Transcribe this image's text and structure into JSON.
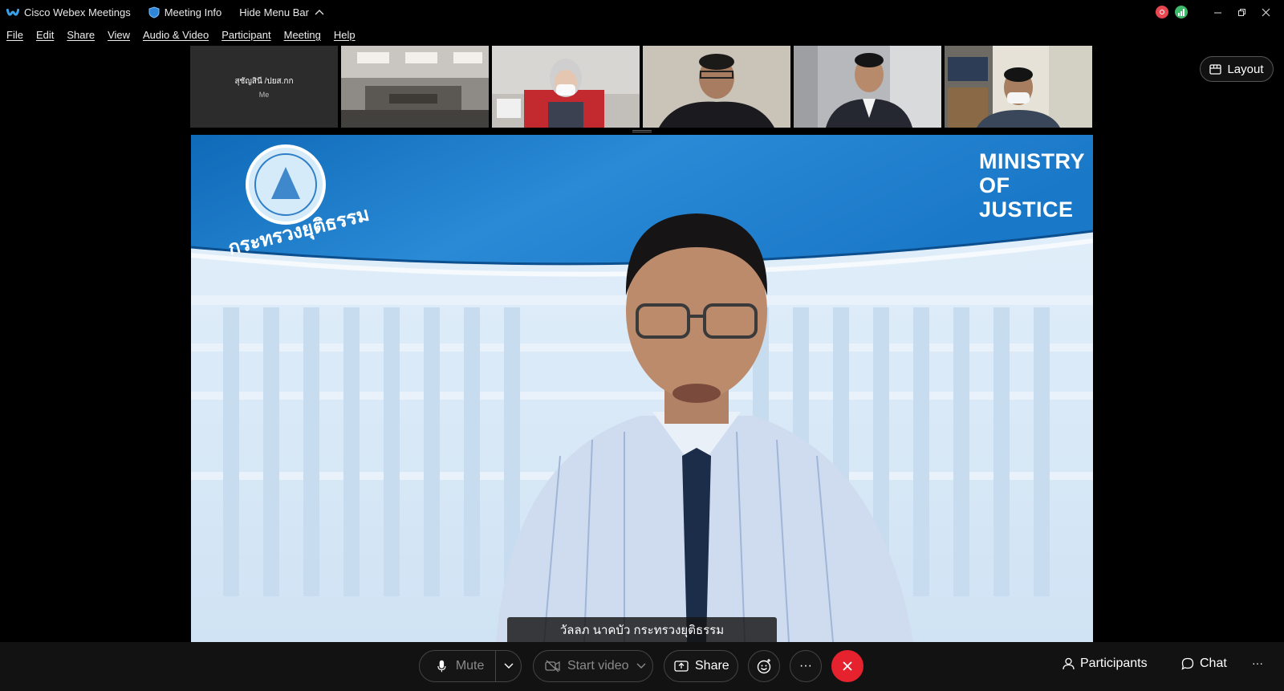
{
  "titlebar": {
    "app_name": "Cisco Webex Meetings",
    "meeting_info": "Meeting Info",
    "hide_menu": "Hide Menu Bar",
    "record_color": "#e8474f",
    "signal_color": "#3dbb6a"
  },
  "menu": [
    "File",
    "Edit",
    "Share",
    "View",
    "Audio & Video",
    "Participant",
    "Meeting",
    "Help"
  ],
  "thumbnails": {
    "me_name": "สุชัญสินี /ปยส.กก",
    "me_label": "Me"
  },
  "layout_label": "Layout",
  "main_video": {
    "banner_title": "MINISTRY OF JUSTICE",
    "banner_line1": "MINISTRY",
    "banner_line2": "OF",
    "banner_line3": "JUSTICE",
    "seal_text": "กระทรวงยุติธรรม",
    "speaker_caption": "วัลลภ นาคบัว กระทรวงยุติธรรม"
  },
  "controls": {
    "mute": "Mute",
    "start_video": "Start video",
    "share": "Share",
    "more": "···",
    "participants": "Participants",
    "chat": "Chat",
    "overflow": "···",
    "end_color": "#e5222e"
  }
}
